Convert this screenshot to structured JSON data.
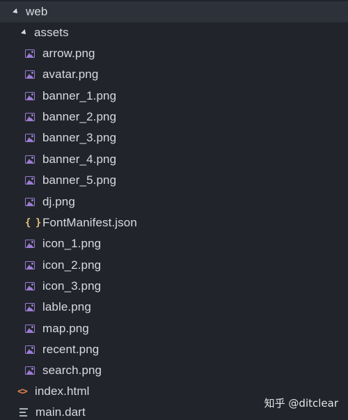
{
  "tree": {
    "root": {
      "label": "web",
      "expanded": true
    },
    "folder": {
      "label": "assets",
      "expanded": true
    },
    "assets": [
      {
        "label": "arrow.png",
        "icon": "image-icon"
      },
      {
        "label": "avatar.png",
        "icon": "image-icon"
      },
      {
        "label": "banner_1.png",
        "icon": "image-icon"
      },
      {
        "label": "banner_2.png",
        "icon": "image-icon"
      },
      {
        "label": "banner_3.png",
        "icon": "image-icon"
      },
      {
        "label": "banner_4.png",
        "icon": "image-icon"
      },
      {
        "label": "banner_5.png",
        "icon": "image-icon"
      },
      {
        "label": "dj.png",
        "icon": "image-icon"
      },
      {
        "label": "FontManifest.json",
        "icon": "json-icon",
        "glyph": "{ }"
      },
      {
        "label": "icon_1.png",
        "icon": "image-icon"
      },
      {
        "label": "icon_2.png",
        "icon": "image-icon"
      },
      {
        "label": "icon_3.png",
        "icon": "image-icon"
      },
      {
        "label": "lable.png",
        "icon": "image-icon"
      },
      {
        "label": "map.png",
        "icon": "image-icon"
      },
      {
        "label": "recent.png",
        "icon": "image-icon"
      },
      {
        "label": "search.png",
        "icon": "image-icon"
      }
    ],
    "web_files": [
      {
        "label": "index.html",
        "icon": "html-icon",
        "glyph": "<>"
      },
      {
        "label": "main.dart",
        "icon": "text-file-icon"
      }
    ]
  },
  "watermark": "知乎 @ditclear",
  "colors": {
    "background": "#21252b",
    "selected_row": "#2c313a",
    "image_icon": "#9c7bd4",
    "json_icon": "#e5c07b",
    "html_icon": "#e8824f",
    "text": "#d7dae0"
  }
}
